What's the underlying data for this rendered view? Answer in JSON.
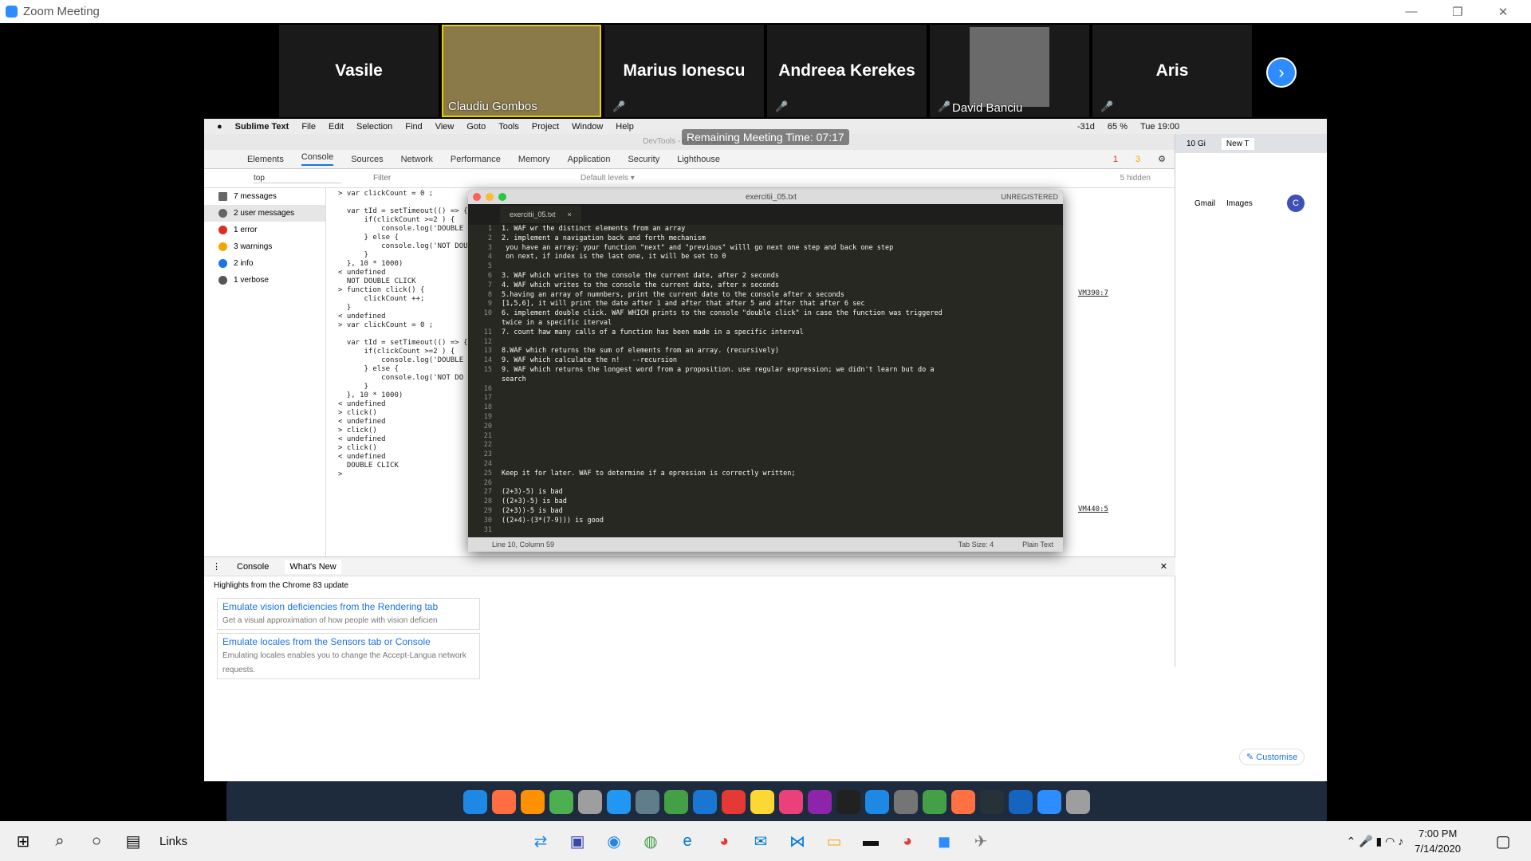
{
  "window": {
    "title": "Zoom Meeting",
    "min": "—",
    "restore": "❐",
    "close": "✕"
  },
  "participants": [
    {
      "name": "Vasile",
      "muted": false
    },
    {
      "name": "Claudiu Gombos",
      "muted": false,
      "video": true
    },
    {
      "name": "Marius Ionescu",
      "muted": true
    },
    {
      "name": "Andreea Kerekes",
      "muted": true
    },
    {
      "name": "David Banciu",
      "muted": true,
      "video": true
    },
    {
      "name": "Aris",
      "muted": true
    }
  ],
  "remaining": "Remaining Meeting Time: 07:17",
  "macmenu": [
    "Sublime Text",
    "File",
    "Edit",
    "Selection",
    "Find",
    "View",
    "Goto",
    "Tools",
    "Project",
    "Window",
    "Help"
  ],
  "macstatus": {
    "temp": "-31d",
    "battery": "65 %",
    "clock": "Tue 19:00"
  },
  "devtools": {
    "header": "DevTools - chrome-search",
    "tabs": [
      "Elements",
      "Console",
      "Sources",
      "Network",
      "Performance",
      "Memory",
      "Application",
      "Security",
      "Lighthouse"
    ],
    "errors": "1",
    "warnings": "3",
    "context": "top",
    "filter_placeholder": "Filter",
    "levels": "Default levels ▾",
    "hidden": "5 hidden",
    "sidebar": [
      {
        "label": "7 messages",
        "color": "#666"
      },
      {
        "label": "2 user messages",
        "color": "#666"
      },
      {
        "label": "1 error",
        "color": "#d93025"
      },
      {
        "label": "3 warnings",
        "color": "#f2a600"
      },
      {
        "label": "2 info",
        "color": "#1a73e8"
      },
      {
        "label": "1 verbose",
        "color": "#555"
      }
    ],
    "console_text": "> var clickCount = 0 ;\n\n  var tId = setTimeout(() => {\n      if(clickCount >=2 ) {\n          console.log('DOUBLE CLICK');\n      } else {\n          console.log('NOT DOUBLE CLICK');\n      }\n  }, 10 * 1000)\n< undefined\n  NOT DOUBLE CLICK\n> function click() {\n      clickCount ++;\n  }\n< undefined\n> var clickCount = 0 ;\n\n  var tId = setTimeout(() => {\n      if(clickCount >=2 ) {\n          console.log('DOUBLE\n      } else {\n          console.log('NOT DO\n      }\n  }, 10 * 1000)\n< undefined\n> click()\n< undefined\n> click()\n< undefined\n> click()\n< undefined\n  DOUBLE CLICK\n>",
    "vm1": "VM390:7",
    "vm2": "VM440:5",
    "drawer_tabs": [
      "Console",
      "What's New"
    ],
    "drawer_title": "Highlights from the Chrome 83 update",
    "cards": [
      {
        "title": "Emulate vision deficiencies from the Rendering tab",
        "desc": "Get a visual approximation of how people with vision deficien"
      },
      {
        "title": "Emulate locales from the Sensors tab or Console",
        "desc": "Emulating locales enables you to change the Accept-Langua network requests."
      }
    ]
  },
  "chrome": {
    "tab1": "10 Gi",
    "tab2": "New T",
    "gmail": "Gmail",
    "images": "Images",
    "avatar": "C",
    "customise": "✎ Customise"
  },
  "sublime": {
    "title": "exercitii_05.txt",
    "unregistered": "UNREGISTERED",
    "tab": "exercitii_05.txt",
    "lines": "1\n2\n3\n4\n5\n6\n7\n8\n9\n10\n\n11\n12\n13\n14\n15\n\n16\n17\n18\n19\n20\n21\n22\n23\n24\n25\n26\n27\n28\n29\n30\n31",
    "code": "1. WAF wr the distinct elements from an array\n2. implement a navigation back and forth mechanism\n you have an array; ypur function \"next\" and \"previous\" willl go next one step and back one step\n on next, if index is the last one, it will be set to 0\n\n3. WAF which writes to the console the current date, after 2 seconds\n4. WAF which writes to the console the current date, after x seconds\n5.having an array of numnbers, print the current date to the console after x seconds\n[1,5,6], it will print the date after 1 and after that after 5 and after that after 6 sec\n6. implement double click. WAF WHICH prints to the console \"double click\" in case the function was triggered\ntwice in a specific iterval\n7. count haw many calls of a function has been made in a specific interval\n\n8.WAF which returns the sum of elements from an array. (recursively)\n9. WAF which calculate the n!   --recursion\n9. WAF which returns the longest word from a proposition. use regular expression; we didn't learn but do a\nsearch\n\n\n\n\n\n\n\n\n\nKeep it for later. WAF to determine if a epression is correctly written;\n\n(2+3)-5) is bad\n((2+3)-5) is bad\n(2+3))-5 is bad\n((2+4)-(3*(7-9))) is good\n",
    "status_pos": "Line 10, Column 59",
    "tabsize": "Tab Size: 4",
    "syntax": "Plain Text"
  },
  "taskbar": {
    "links": "Links",
    "time": "7:00 PM",
    "date": "7/14/2020"
  }
}
